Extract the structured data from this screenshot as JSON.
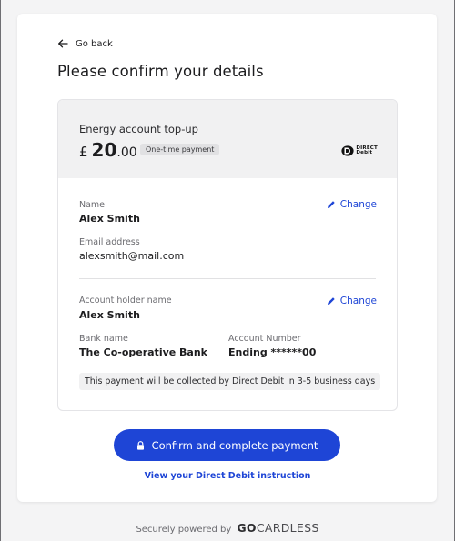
{
  "nav": {
    "back_label": "Go back"
  },
  "page": {
    "title": "Please confirm your details"
  },
  "payment": {
    "description": "Energy account top-up",
    "currency_symbol": "£",
    "amount_major": "20",
    "amount_minor": ".00",
    "badge": "One-time payment",
    "scheme_logo": {
      "line1": "DIRECT",
      "line2": "Debit"
    }
  },
  "customer": {
    "name_label": "Name",
    "name_value": "Alex Smith",
    "email_label": "Email address",
    "email_value": "alexsmith@mail.com",
    "change_label": "Change"
  },
  "bank": {
    "holder_label": "Account holder name",
    "holder_value": "Alex Smith",
    "bank_label": "Bank name",
    "bank_value": "The Co-operative Bank",
    "account_label": "Account Number",
    "account_value": "Ending ******00",
    "change_label": "Change",
    "notice": "This payment will be collected by Direct Debit in 3-5 business days"
  },
  "actions": {
    "confirm_label": "Confirm and complete payment",
    "instruction_link": "View your Direct Debit instruction"
  },
  "footer": {
    "powered_by": "Securely powered by",
    "brand_bold": "GO",
    "brand_rest": "CARDLESS"
  },
  "colors": {
    "accent": "#1e45d6",
    "background": "#f4f4f5",
    "panel": "#f1f1f2"
  },
  "icons": {
    "back": "arrow-left-icon",
    "change": "pencil-icon",
    "confirm": "lock-icon",
    "scheme": "direct-debit-logo-icon"
  }
}
